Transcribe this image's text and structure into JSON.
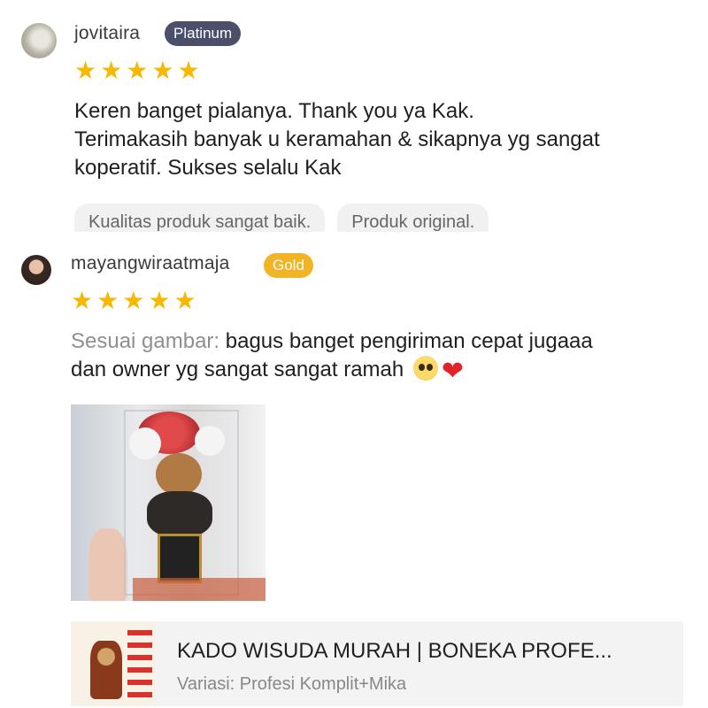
{
  "reviews": [
    {
      "username": "jovitaira",
      "badge": "Platinum",
      "rating": 5,
      "stars": [
        "★",
        "★",
        "★",
        "★",
        "★"
      ],
      "comment_lines": [
        "Keren banget pialanya. Thank you ya Kak.",
        "Terimakasih banyak u keramahan & sikapnya yg sangat",
        "koperatif. Sukses selalu Kak"
      ],
      "tags": [
        "Kualitas produk sangat baik.",
        "Produk original."
      ]
    },
    {
      "username": "mayangwiraatmaja",
      "badge": "Gold",
      "rating": 5,
      "stars": [
        "★",
        "★",
        "★",
        "★",
        "★"
      ],
      "comment_label": "Sesuai gambar:",
      "comment_line1": " bagus banget pengiriman cepat jugaaa",
      "comment_line2": "dan owner yg sangat sangat ramah ",
      "emoji_heart": "❤",
      "product": {
        "title": "KADO WISUDA MURAH | BONEKA PROFE...",
        "variant": "Variasi: Profesi Komplit+Mika"
      }
    }
  ],
  "colors": {
    "star": "#f6b800",
    "badge_platinum": "#4a4f6a",
    "badge_gold": "#f2b324",
    "muted": "#8f8f8f"
  },
  "icons": {
    "star": "star-icon",
    "emoji_face": "pleading-face-emoji",
    "emoji_heart": "red-heart-emoji"
  }
}
